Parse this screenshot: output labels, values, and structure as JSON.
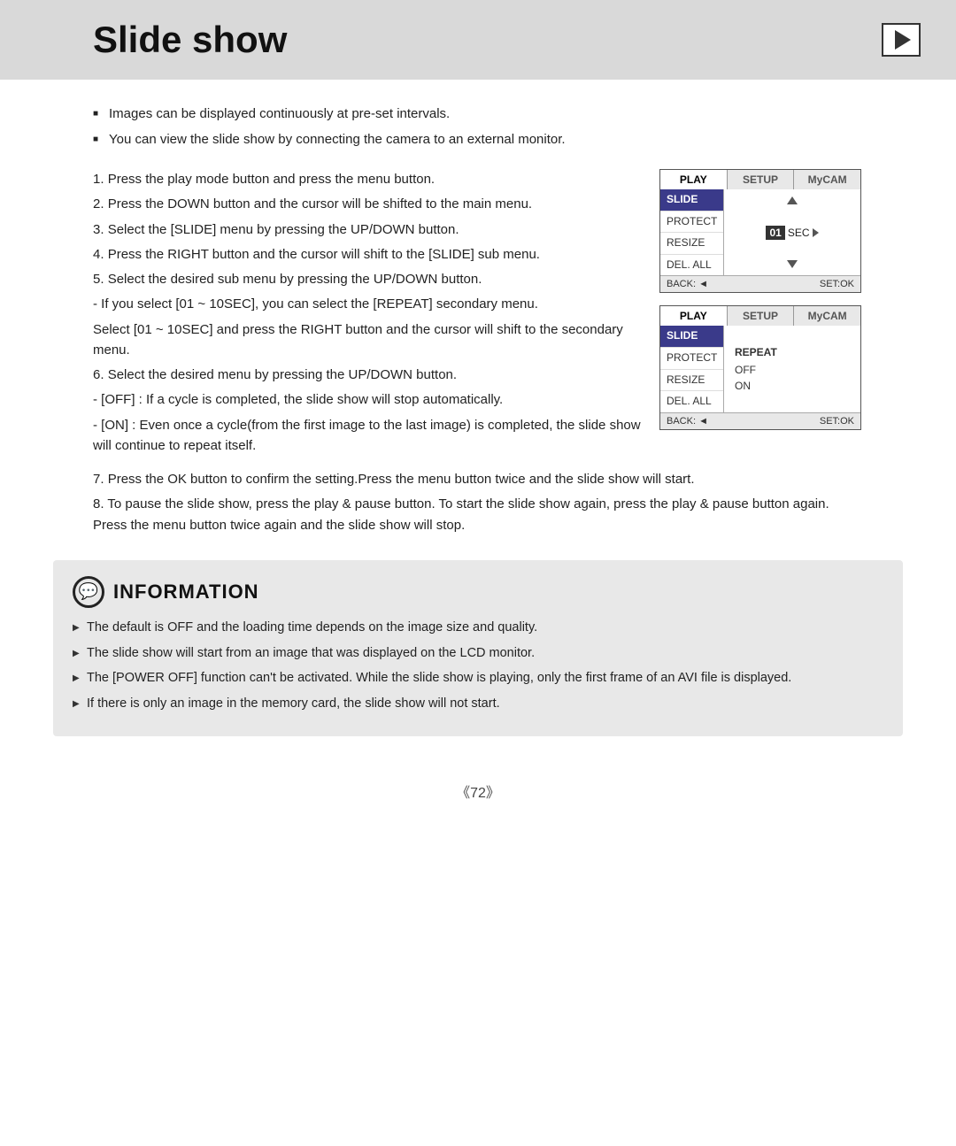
{
  "header": {
    "title": "Slide show",
    "play_icon_label": "play"
  },
  "intro_bullets": [
    "Images can be displayed continuously at pre-set intervals.",
    "You can view the slide show by connecting the camera to an external monitor."
  ],
  "steps": [
    {
      "num": "1.",
      "text": "Press the play mode button and press the menu button."
    },
    {
      "num": "2.",
      "text": "Press the DOWN button and the cursor will be shifted to the main menu."
    },
    {
      "num": "3.",
      "text": "Select the [SLIDE] menu by pressing the UP/DOWN button."
    },
    {
      "num": "4.",
      "text": "Press the RIGHT button and the cursor will shift to the [SLIDE] sub menu."
    },
    {
      "num": "5.",
      "text": "Select the desired sub menu by pressing the UP/DOWN button."
    },
    {
      "num": "5a_sub",
      "text": "- If you select [01 ~ 10SEC], you can select the [REPEAT] secondary menu."
    },
    {
      "num": "5b_sub",
      "text": "Select [01 ~ 10SEC] and press the RIGHT button and the cursor will shift to the secondary menu."
    },
    {
      "num": "6.",
      "text": "Select the desired menu by pressing the UP/DOWN button."
    },
    {
      "num": "6a_sub",
      "text": "- [OFF]  : If a cycle is completed, the slide show will stop automatically."
    },
    {
      "num": "6b_sub",
      "text": "- [ON]   : Even once a cycle(from the first image to the last image) is completed, the slide show will continue to repeat itself."
    },
    {
      "num": "7.",
      "text": "Press the OK button to confirm the setting.Press the menu button twice and the slide show will start."
    },
    {
      "num": "8.",
      "text": "To pause the slide show, press the play & pause button. To start the slide show again, press the play & pause button again. Press the menu button twice again and the slide show will stop."
    }
  ],
  "menu1": {
    "tabs": [
      "PLAY",
      "SETUP",
      "MyCAM"
    ],
    "active_tab": "PLAY",
    "rows": [
      "SLIDE",
      "PROTECT",
      "RESIZE",
      "DEL. ALL"
    ],
    "selected_row": "SLIDE",
    "right_sec_val": "01",
    "right_sec_label": "SEC",
    "back_label": "BACK: ◄",
    "set_label": "SET:OK"
  },
  "menu2": {
    "tabs": [
      "PLAY",
      "SETUP",
      "MyCAM"
    ],
    "active_tab": "PLAY",
    "rows": [
      "SLIDE",
      "PROTECT",
      "RESIZE",
      "DEL. ALL"
    ],
    "selected_row": "SLIDE",
    "right_label": "REPEAT",
    "right_options": [
      "OFF",
      "ON"
    ],
    "back_label": "BACK: ◄",
    "set_label": "SET:OK"
  },
  "information": {
    "title": "INFORMATION",
    "bullets": [
      "The default is OFF and the loading time depends on the image size and quality.",
      "The slide show will start from an image that was displayed on the LCD monitor.",
      "The [POWER OFF] function can't be activated. While the slide show is playing, only the first frame of an AVI file is displayed.",
      "If there is only an image in the memory card, the slide show will not start."
    ]
  },
  "page_number": "《72》"
}
